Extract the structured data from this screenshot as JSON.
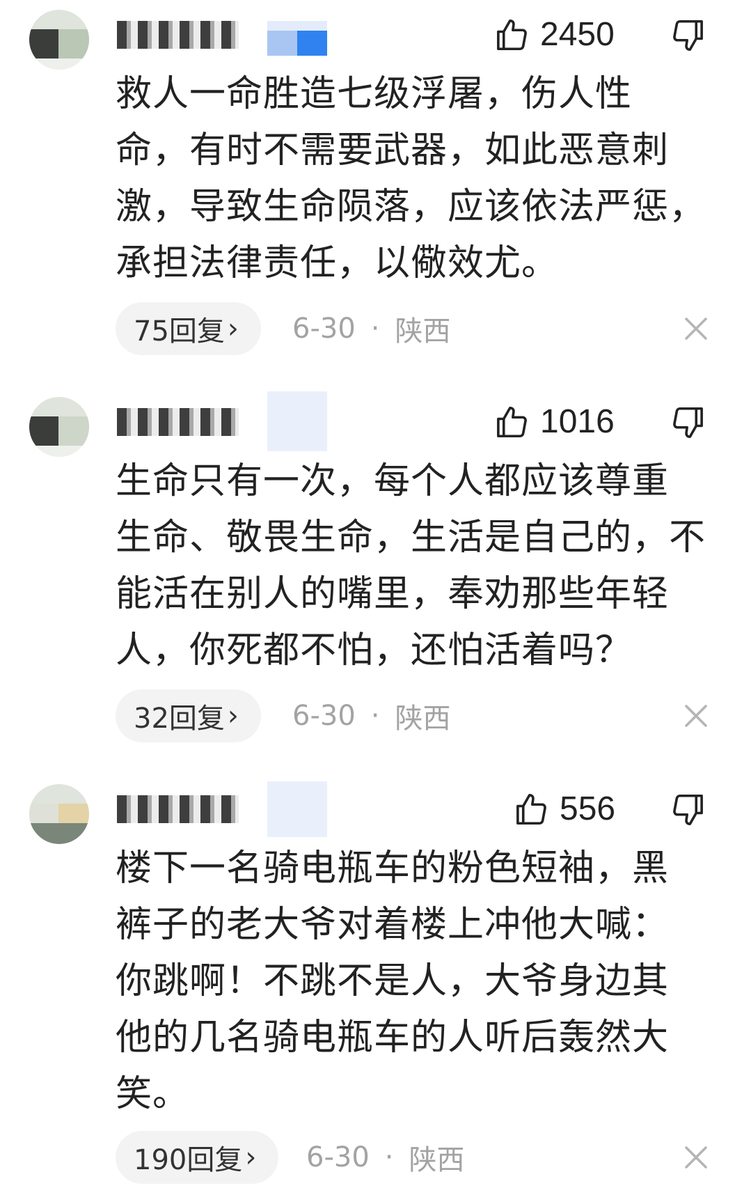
{
  "comments": [
    {
      "username": "",
      "likes": "2450",
      "text": "救人一命胜造七级浮屠，伤人性命，有时不需要武器，如此恶意刺激，导致生命陨落，应该依法严惩，承担法律责任，以儆效尤。",
      "lines": [
        "救人一命胜造七级浮屠，伤人性",
        "命，有时不需要武器，如此恶意刺",
        "激，导致生命陨落，应该依法严惩，",
        "承担法律责任，以儆效尤。"
      ],
      "replies": "75回复",
      "date": "6-30",
      "location": "陕西"
    },
    {
      "username": "",
      "likes": "1016",
      "text": "生命只有一次，每个人都应该尊重生命、敬畏生命，生活是自己的，不能活在别人的嘴里，奉劝那些年轻人，你死都不怕，还怕活着吗？",
      "lines": [
        "生命只有一次，每个人都应该尊重",
        "生命、敬畏生命，生活是自己的，不",
        "能活在别人的嘴里，奉劝那些年轻",
        "人，你死都不怕，还怕活着吗？"
      ],
      "replies": "32回复",
      "date": "6-30",
      "location": "陕西"
    },
    {
      "username": "",
      "likes": "556",
      "text": "楼下一名骑电瓶车的粉色短袖，黑裤子的老大爷对着楼上冲他大喊：你跳啊！不跳不是人，大爷身边其他的几名骑电瓶车的人听后轰然大笑。",
      "lines": [
        "楼下一名骑电瓶车的粉色短袖，黑",
        "裤子的老大爷对着楼上冲他大喊：",
        "你跳啊！不跳不是人，大爷身边其",
        "他的几名骑电瓶车的人听后轰然大",
        "笑。"
      ],
      "replies": "190回复",
      "date": "6-30",
      "location": "陕西"
    }
  ],
  "icons": {
    "like": "thumbs-up-icon",
    "dislike": "thumbs-down-icon",
    "close": "close-icon",
    "chevron": "chevron-right-icon"
  },
  "colors": {
    "text": "#222222",
    "meta": "#a3a3a3",
    "pill": "#f3f3f3",
    "badge_blue": "#2f82f0"
  }
}
